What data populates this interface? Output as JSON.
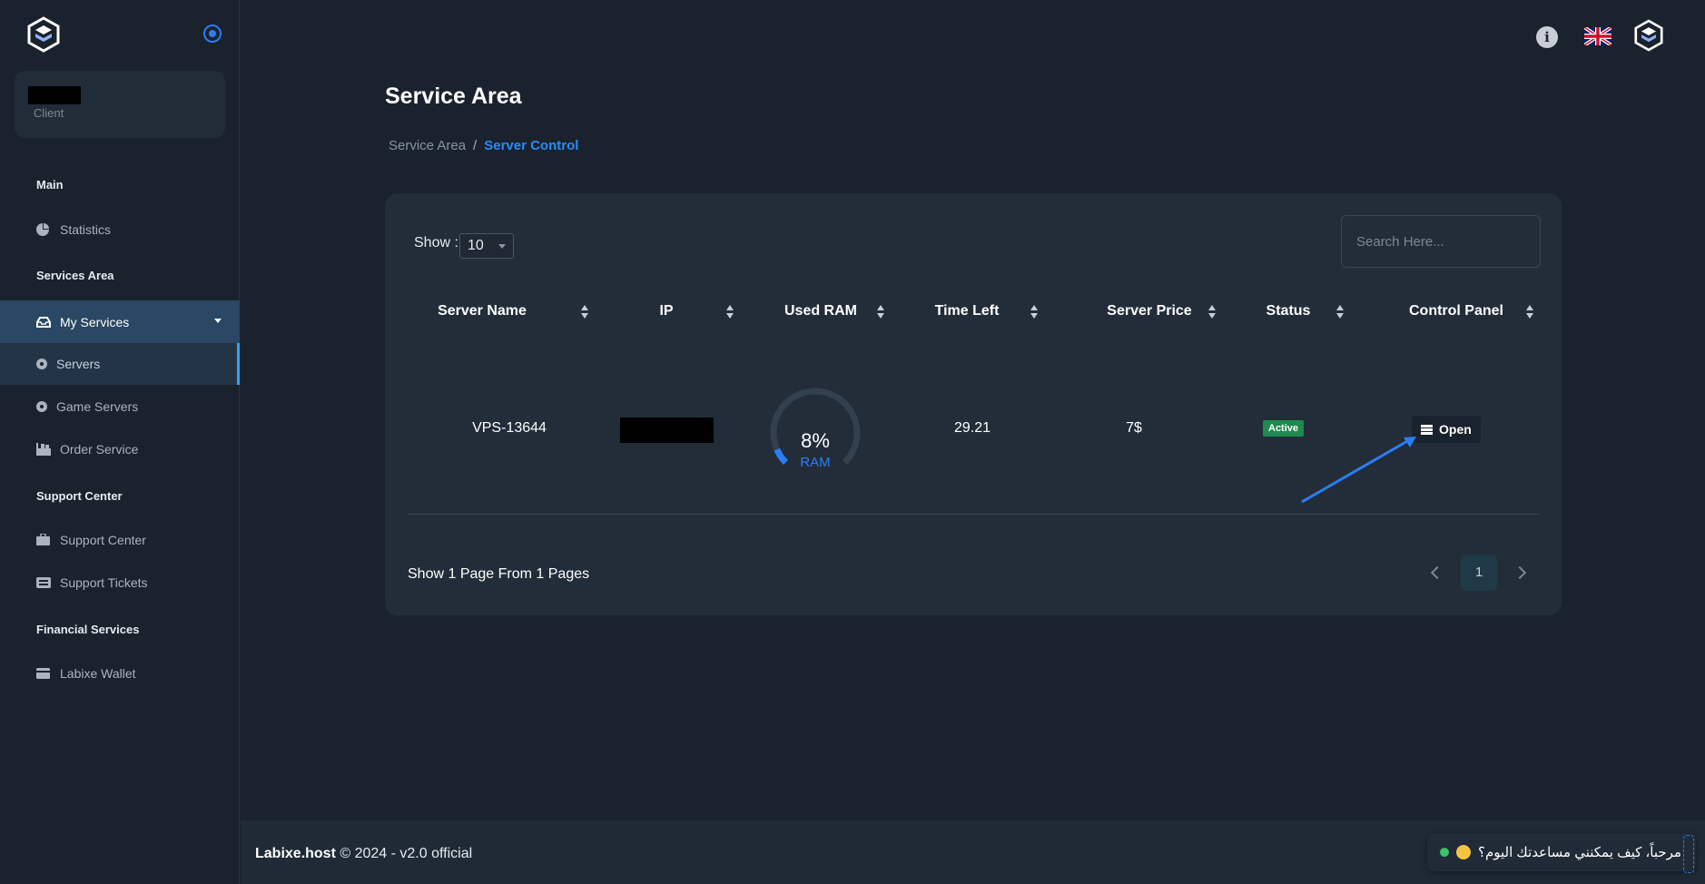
{
  "sidebar": {
    "user": {
      "role": "Client"
    },
    "sections": {
      "main": "Main",
      "services_area": "Services Area",
      "support_center": "Support Center",
      "financial": "Financial Services"
    },
    "items": {
      "statistics": "Statistics",
      "my_services": "My Services",
      "servers": "Servers",
      "game_servers": "Game Servers",
      "order_service": "Order Service",
      "support_center": "Support Center",
      "support_tickets": "Support Tickets",
      "wallet": "Labixe Wallet"
    }
  },
  "header": {
    "info_icon": "i",
    "language_icon": "uk-flag-icon"
  },
  "page": {
    "title": "Service Area",
    "breadcrumb": {
      "parent": "Service Area",
      "separator": "/",
      "current": "Server Control"
    }
  },
  "table_controls": {
    "show_label": "Show :",
    "page_size": "10",
    "search_placeholder": "Search Here..."
  },
  "table": {
    "columns": [
      "Server Name",
      "IP",
      "Used RAM",
      "Time Left",
      "Server Price",
      "Status",
      "Control Panel"
    ],
    "rows": [
      {
        "server_name": "VPS-13644",
        "ram_percent_text": "8%",
        "ram_percent": 8,
        "ram_label": "RAM",
        "time_left": "29.21",
        "price": "7$",
        "status": "Active",
        "action": "Open"
      }
    ]
  },
  "pagination": {
    "info": "Show 1 Page From 1 Pages",
    "current": "1"
  },
  "footer": {
    "brand": "Labixe.host",
    "text": " © 2024 - v2.0 official"
  },
  "chat": {
    "greeting": "مرحباً، كيف يمكنني مساعدتك اليوم؟"
  },
  "colors": {
    "accent": "#2a7ef5",
    "status_active": "#1e8a4f",
    "background": "#1a222d",
    "card": "#232d39"
  }
}
